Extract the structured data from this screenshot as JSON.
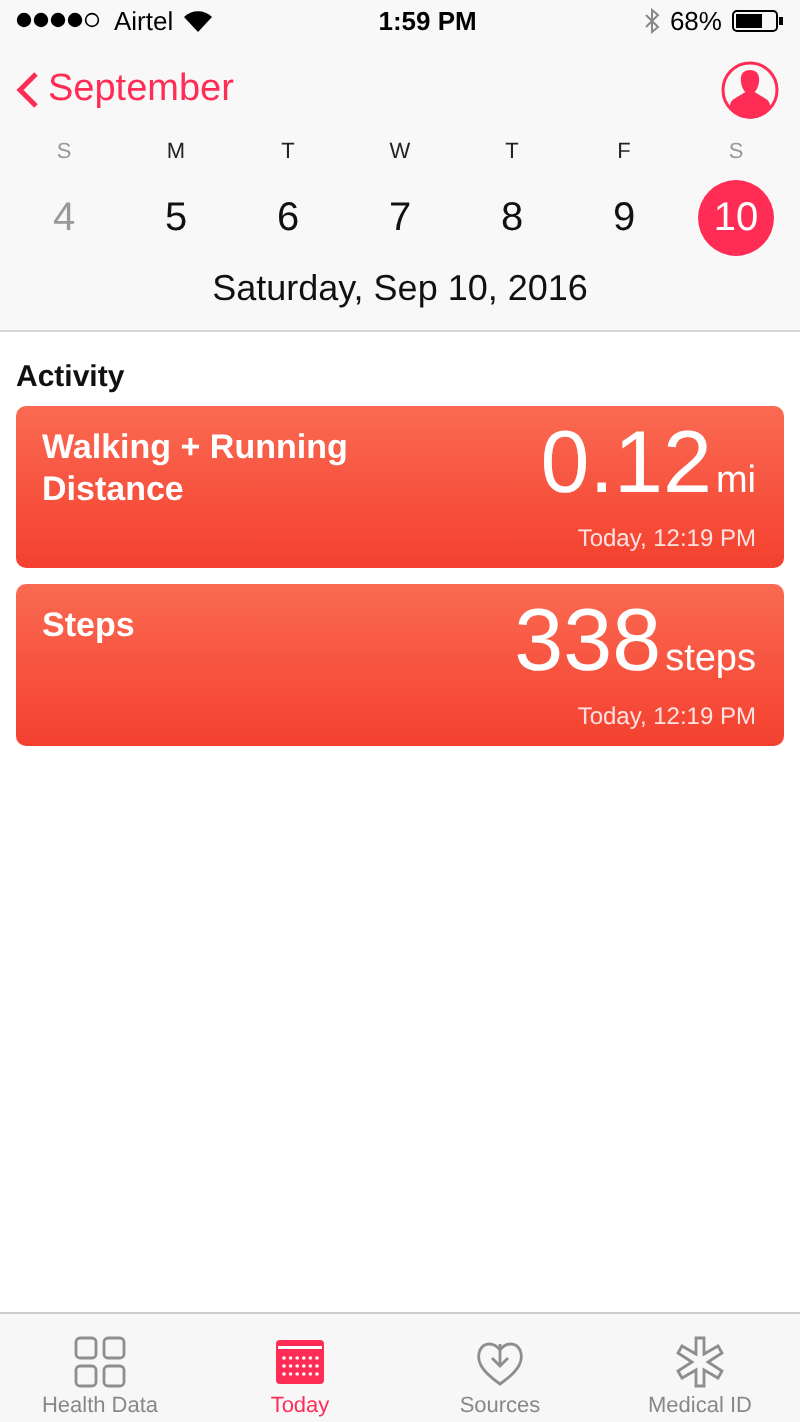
{
  "status_bar": {
    "carrier": "Airtel",
    "time": "1:59 PM",
    "battery": "68%"
  },
  "nav": {
    "back": "September"
  },
  "week": [
    {
      "letter": "S",
      "day": "4",
      "weekend": true,
      "selected": false
    },
    {
      "letter": "M",
      "day": "5",
      "weekend": false,
      "selected": false
    },
    {
      "letter": "T",
      "day": "6",
      "weekend": false,
      "selected": false
    },
    {
      "letter": "W",
      "day": "7",
      "weekend": false,
      "selected": false
    },
    {
      "letter": "T",
      "day": "8",
      "weekend": false,
      "selected": false
    },
    {
      "letter": "F",
      "day": "9",
      "weekend": false,
      "selected": false
    },
    {
      "letter": "S",
      "day": "10",
      "weekend": true,
      "selected": true
    }
  ],
  "date_title": "Saturday, Sep 10, 2016",
  "section": "Activity",
  "cards": [
    {
      "title": "Walking + Running Distance",
      "value": "0.12",
      "unit": "mi",
      "time": "Today, 12:19 PM"
    },
    {
      "title": "Steps",
      "value": "338",
      "unit": "steps",
      "time": "Today, 12:19 PM"
    }
  ],
  "tabs": [
    {
      "label": "Health Data",
      "kind": "grid",
      "selected": false
    },
    {
      "label": "Today",
      "kind": "calendar",
      "selected": true
    },
    {
      "label": "Sources",
      "kind": "heart",
      "selected": false
    },
    {
      "label": "Medical ID",
      "kind": "asterisk",
      "selected": false
    }
  ]
}
